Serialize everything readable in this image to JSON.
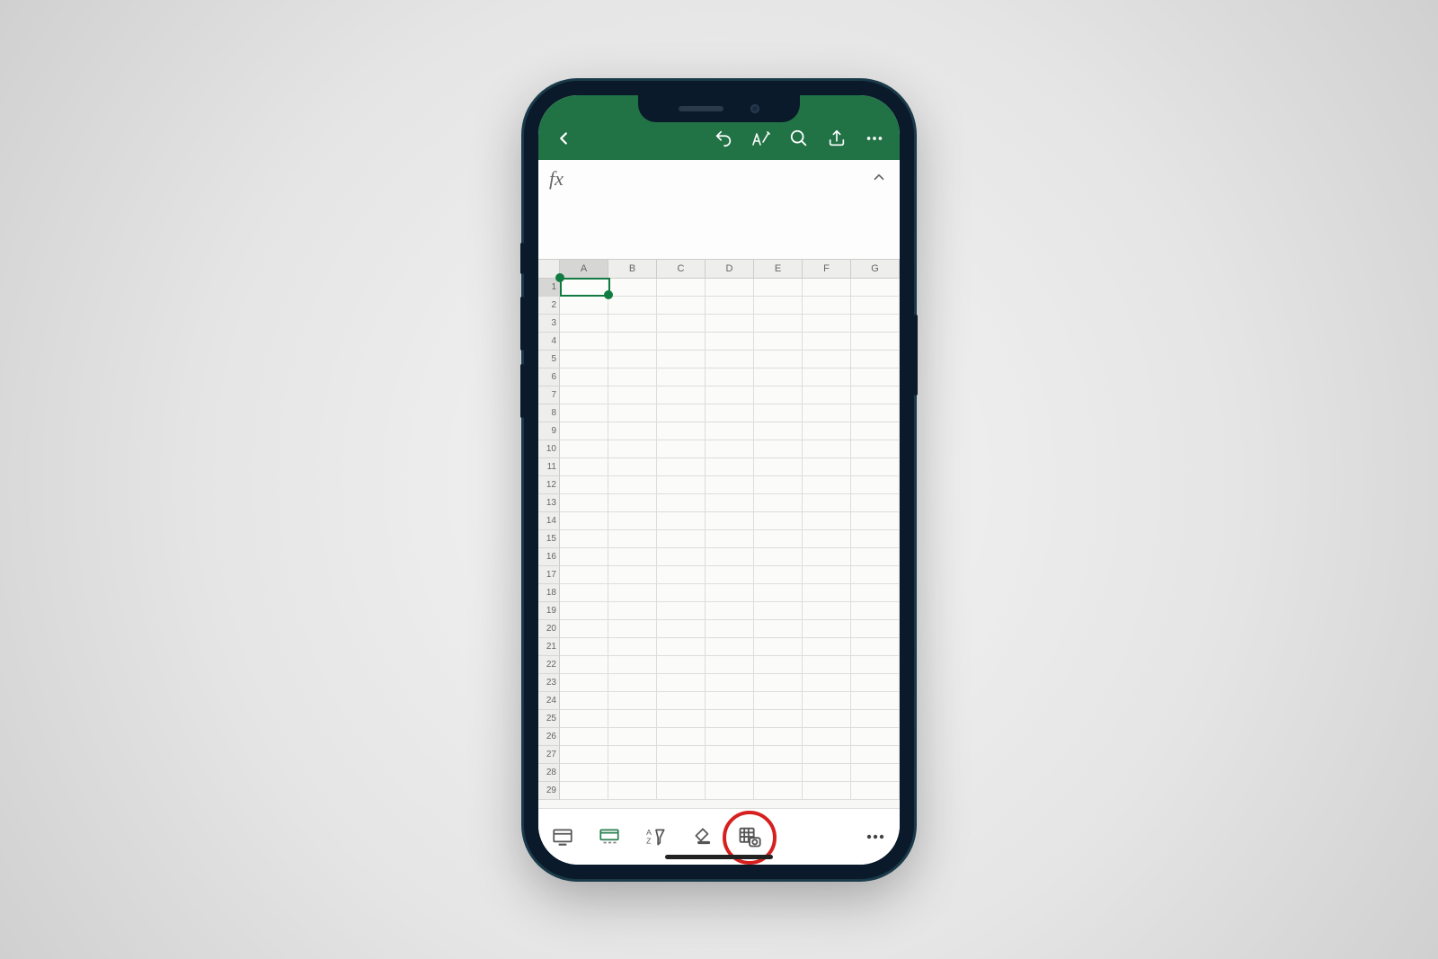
{
  "header": {
    "back_icon": "back",
    "undo_icon": "undo",
    "format_icon": "format-pen",
    "search_icon": "search",
    "share_icon": "share",
    "more_icon": "more"
  },
  "formula_bar": {
    "fx_label": "fx",
    "content": "",
    "expand_icon": "chevron-up"
  },
  "sheet": {
    "columns": [
      "A",
      "B",
      "C",
      "D",
      "E",
      "F",
      "G"
    ],
    "rows": [
      "1",
      "2",
      "3",
      "4",
      "5",
      "6",
      "7",
      "8",
      "9",
      "10",
      "11",
      "12",
      "13",
      "14",
      "15",
      "16",
      "17",
      "18",
      "19",
      "20",
      "21",
      "22",
      "23",
      "24",
      "25",
      "26",
      "27",
      "28",
      "29"
    ],
    "selected_cell": "A1"
  },
  "bottom_bar": {
    "card_view_icon": "card-view",
    "sheet_tabs_icon": "sheet-tabs",
    "sort_filter_icon": "sort-filter",
    "highlight_icon": "highlight-fill",
    "data_from_picture_icon": "data-from-picture",
    "more_icon": "more",
    "highlighted_tool": "data-from-picture"
  }
}
